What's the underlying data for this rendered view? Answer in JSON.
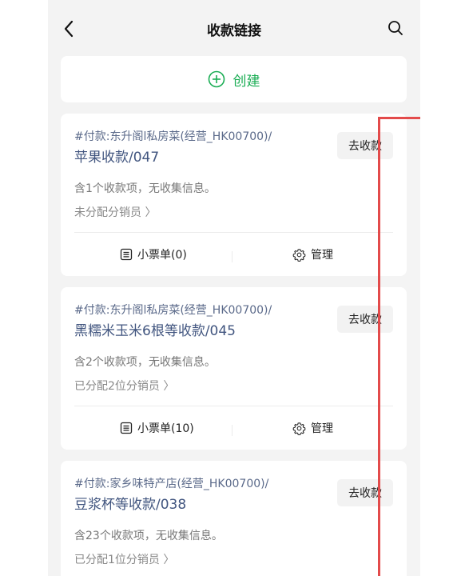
{
  "header": {
    "title": "收款链接",
    "back_icon": "chevron-left-icon",
    "search_icon": "search-icon"
  },
  "create": {
    "label": "创建",
    "icon": "plus-circle-icon",
    "color": "#1aad54"
  },
  "cards": [
    {
      "payer": "#付款:东升阁l私房菜(经营_HK00700)/",
      "title": "苹果收款/047",
      "items_info": "含1个收款项，无收集信息。",
      "assign_info": "未分配分销员 〉",
      "collect_label": "去收款",
      "receipt_label": "小票单(0)",
      "manage_label": "管理"
    },
    {
      "payer": "#付款:东升阁l私房菜(经营_HK00700)/",
      "title": "黑糯米玉米6根等收款/045",
      "items_info": "含2个收款项，无收集信息。",
      "assign_info": "已分配2位分销员 〉",
      "collect_label": "去收款",
      "receipt_label": "小票单(10)",
      "manage_label": "管理"
    },
    {
      "payer": "#付款:家乡味特产店(经营_HK00700)/",
      "title": "豆浆杯等收款/038",
      "items_info": "含23个收款项，无收集信息。",
      "assign_info": "已分配1位分销员 〉",
      "collect_label": "去收款"
    }
  ],
  "highlight_color": "#e34b4b"
}
